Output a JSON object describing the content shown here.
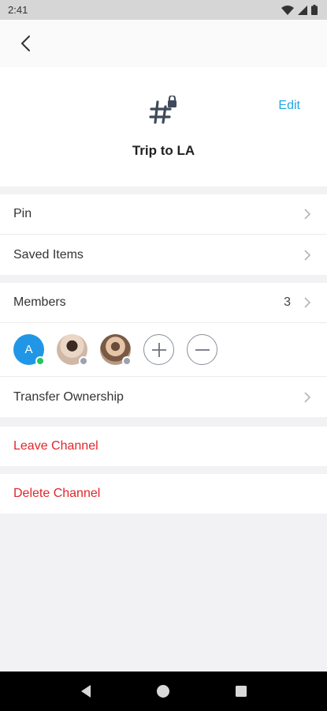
{
  "status_bar": {
    "time": "2:41"
  },
  "channel": {
    "name": "Trip to LA",
    "edit_label": "Edit"
  },
  "menu": {
    "pin_label": "Pin",
    "saved_items_label": "Saved Items"
  },
  "members": {
    "label": "Members",
    "count": "3",
    "avatars": [
      {
        "initial": "A",
        "status_color": "#22c55e"
      },
      {
        "status_color": "#9ca3af"
      },
      {
        "status_color": "#9ca3af"
      }
    ]
  },
  "transfer_ownership_label": "Transfer Ownership",
  "leave_channel_label": "Leave Channel",
  "delete_channel_label": "Delete Channel",
  "colors": {
    "accent": "#22a6e2",
    "danger": "#e0262b",
    "avatar_blue": "#2196e6"
  }
}
